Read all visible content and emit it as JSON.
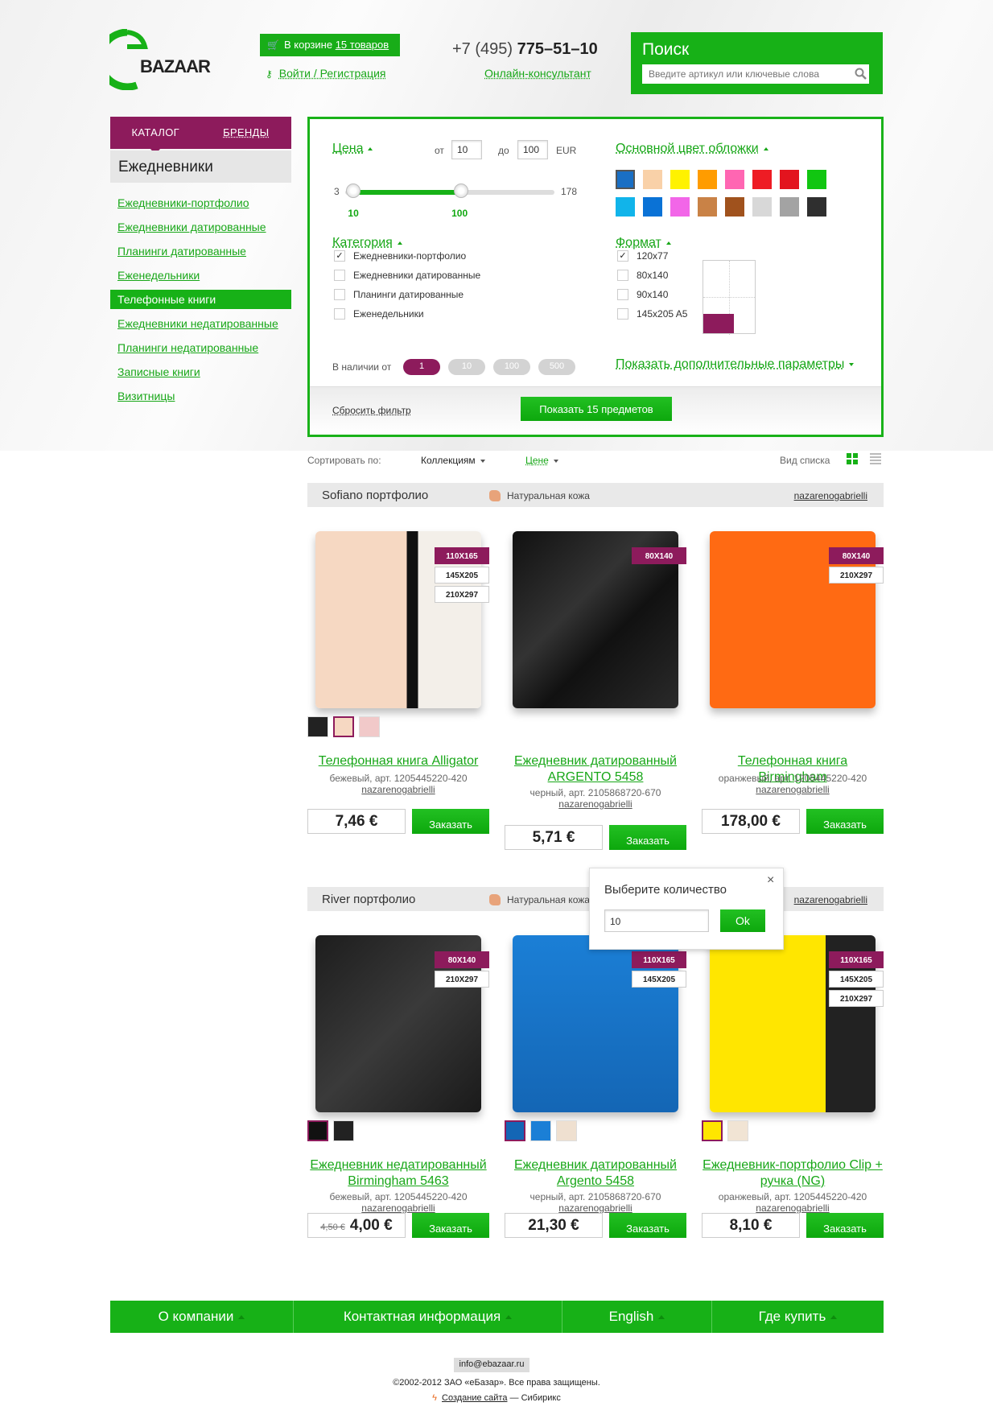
{
  "header": {
    "logo_text": "BAZAAR",
    "cart_prefix": "В корзине",
    "cart_count": "15 товаров",
    "login": "Войти / Регистрация",
    "phone_prefix": "+7 (495)",
    "phone_number": "775–51–10",
    "consultant": "Онлайн-консультант",
    "search_title": "Поиск",
    "search_placeholder": "Введите артикул или ключевые слова"
  },
  "sidebar": {
    "tabs": [
      "КАТАЛОГ",
      "БРЕНДЫ"
    ],
    "category_title": "Ежедневники",
    "items": [
      {
        "label": "Ежедневники-портфолио",
        "active": false
      },
      {
        "label": "Ежедневники датированные",
        "active": false
      },
      {
        "label": "Планинги датированные",
        "active": false
      },
      {
        "label": "Еженедельники",
        "active": false
      },
      {
        "label": "Телефонные книги",
        "active": true
      },
      {
        "label": "Ежедневники недатированные",
        "active": false
      },
      {
        "label": "Планинги недатированные",
        "active": false
      },
      {
        "label": "Записные книги",
        "active": false
      },
      {
        "label": "Визитницы",
        "active": false
      }
    ]
  },
  "filter": {
    "price_label": "Цена",
    "from_label": "от",
    "from_value": "10",
    "to_label": "до",
    "to_value": "100",
    "currency": "EUR",
    "range_min": "3",
    "range_max": "178",
    "slider_low": "10",
    "slider_high": "100",
    "color_label": "Основной цвет обложки",
    "colors": [
      "#1a6fc4",
      "#f9d1a8",
      "#fff200",
      "#ff9c00",
      "#ff66b2",
      "#ee1c24",
      "#e3141e",
      "#11c611",
      "#11b4ea",
      "#0a72d6",
      "#f266e8",
      "#c98246",
      "#a0521d",
      "#d8d8d8",
      "#a3a3a3",
      "#2f2f2f"
    ],
    "category_label": "Категория",
    "categories": [
      {
        "label": "Ежедневники-портфолио",
        "checked": true
      },
      {
        "label": "Ежедневники датированные",
        "checked": false
      },
      {
        "label": "Планинги датированные",
        "checked": false
      },
      {
        "label": "Еженедельники",
        "checked": false
      }
    ],
    "format_label": "Формат",
    "formats": [
      {
        "label": "120x77",
        "checked": true
      },
      {
        "label": "80x140",
        "checked": false
      },
      {
        "label": "90x140",
        "checked": false
      },
      {
        "label": "145x205 A5",
        "checked": false
      }
    ],
    "stock_label": "В наличии от",
    "stock_options": [
      "1",
      "10",
      "100",
      "500"
    ],
    "more_params": "Показать дополнительные параметры",
    "reset": "Сбросить фильтр",
    "show_button": "Показать 15 предметов"
  },
  "sort": {
    "label": "Сортировать по:",
    "collections": "Коллекциям",
    "price": "Цене",
    "view_label": "Вид списка"
  },
  "groups": [
    {
      "name": "Sofiano портфолио",
      "leather": "Натуральная кожа",
      "brand": "nazarenogabrielli",
      "products": [
        {
          "title": "Телефонная книга Alligator",
          "meta": "бежевый, арт. 1205445220-420",
          "brand": "nazarenogabrielli",
          "price": "7,46 €",
          "old_price": "",
          "order": "Заказать",
          "sizes": [
            "110X165",
            "145X205",
            "210X297"
          ]
        },
        {
          "title": "Ежедневник датированный ARGENTO 5458",
          "meta": "черный, арт. 2105868720-670",
          "brand": "nazarenogabrielli",
          "price": "5,71 €",
          "old_price": "",
          "order": "Заказать",
          "sizes": [
            "80X140"
          ]
        },
        {
          "title": "Телефонная книга Birmingham",
          "meta": "оранжевый, арт. 1205445220-420",
          "brand": "nazarenogabrielli",
          "price": "178,00 €",
          "old_price": "",
          "order": "Заказать",
          "sizes": [
            "80X140",
            "210X297"
          ]
        }
      ]
    },
    {
      "name": "River портфолио",
      "leather": "Натуральная кожа",
      "brand": "nazarenogabrielli",
      "products": [
        {
          "title": "Ежедневник недатированный Birmingham 5463",
          "meta": "бежевый, арт. 1205445220-420",
          "brand": "nazarenogabrielli",
          "price": "4,00 €",
          "old_price": "4,50 €",
          "order": "Заказать",
          "sizes": [
            "80X140",
            "210X297"
          ]
        },
        {
          "title": "Ежедневник датированный Argento 5458",
          "meta": "черный, арт. 2105868720-670",
          "brand": "nazarenogabrielli",
          "price": "21,30 €",
          "old_price": "",
          "order": "Заказать",
          "sizes": [
            "110X165",
            "145X205"
          ]
        },
        {
          "title": "Ежедневник-портфолио Clip + ручка (NG)",
          "meta": "оранжевый, арт. 1205445220-420",
          "brand": "nazarenogabrielli",
          "price": "8,10 €",
          "old_price": "",
          "order": "Заказать",
          "sizes": [
            "110X165",
            "145X205",
            "210X297"
          ]
        }
      ]
    }
  ],
  "popup": {
    "title": "Выберите количество",
    "value": "10",
    "ok": "Ok"
  },
  "footer": {
    "nav": [
      "О компании",
      "Контактная информация",
      "English",
      "Где купить"
    ],
    "email": "info@ebazaar.ru",
    "copyright": "©2002-2012 ЗАО «еБазар». Все права защищены.",
    "credit_link": "Создание сайта",
    "credit_suffix": "— Сибирикс"
  }
}
